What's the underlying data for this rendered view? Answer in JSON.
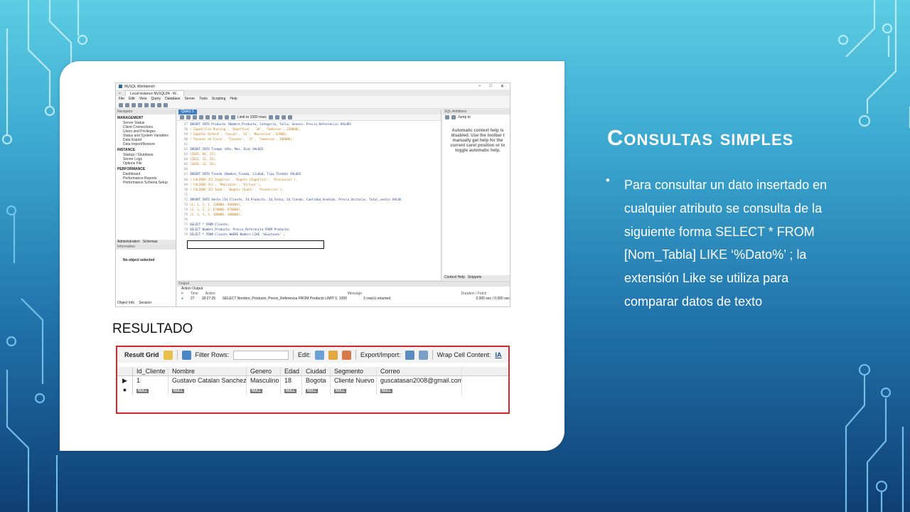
{
  "slide": {
    "title": "Consultas simples",
    "bullet": "Para consultar un dato insertado en cualquier atributo se consulta de la siguiente forma SELECT * FROM  [Nom_Tabla] LIKE ‘%Dato%’ ; la extensión Like se utiliza para comparar datos de texto",
    "resultado_label": "RESULTADO"
  },
  "workbench": {
    "title": "MySQL Workbench",
    "tab": "Local instance MySQL84 - W...",
    "menu": [
      "File",
      "Edit",
      "View",
      "Query",
      "Database",
      "Server",
      "Tools",
      "Scripting",
      "Help"
    ],
    "navigator": {
      "header": "Navigator",
      "management_label": "MANAGEMENT",
      "management_items": [
        "Server Status",
        "Client Connections",
        "Users and Privileges",
        "Status and System Variables",
        "Data Export",
        "Data Import/Restore"
      ],
      "instance_label": "INSTANCE",
      "instance_items": [
        "Startup / Shutdown",
        "Server Logs",
        "Options File"
      ],
      "performance_label": "PERFORMANCE",
      "performance_items": [
        "Dashboard",
        "Performance Reports",
        "Performance Schema Setup"
      ],
      "tabs": [
        "Administration",
        "Schemas"
      ],
      "info_header": "Information",
      "info_text": "No object selected",
      "footer_tabs": [
        "Object Info",
        "Session"
      ]
    },
    "query_tab": "Query 1",
    "limit_label": "Limit to 1000 rows",
    "code_lines": [
      {
        "n": "57",
        "t": "INSERT INTO Producto (Nombre_Producto, Categoria, Talla, Genero, Precio_Referencia) VALUES",
        "s": false
      },
      {
        "n": "58",
        "t": "('Zapatillas Running', 'Deportivo', '38', 'Femenino', 230000),",
        "s": true
      },
      {
        "n": "59",
        "t": "('Zapatos Oxford', 'Casual', '42', 'Masculino', 67000),",
        "s": true
      },
      {
        "n": "60",
        "t": "('Tacones de Cuero', 'Tacones', '37', 'Femenino', 100000);",
        "s": true
      },
      {
        "n": "61",
        "t": "",
        "s": false
      },
      {
        "n": "62",
        "t": "INSERT INTO Tiempo (Año, Mes, Dia) VALUES",
        "s": false
      },
      {
        "n": "63",
        "t": "(2024, 09, 23),",
        "s": true
      },
      {
        "n": "64",
        "t": "(2022, 12, 24),",
        "s": true
      },
      {
        "n": "65",
        "t": "(2024, 12, 24);",
        "s": true
      },
      {
        "n": "66",
        "t": "",
        "s": false
      },
      {
        "n": "67",
        "t": "INSERT INTO Tienda (Nombre_Tienda, Ciudad, Tipo_Tienda) VALUES",
        "s": false
      },
      {
        "n": "68",
        "t": "('CALZADO JC2 Zagatiza', 'Bogota (Zagatiza)', 'Presencial'),",
        "s": true
      },
      {
        "n": "69",
        "t": "('CALZADO JL1', 'Manizales', 'Virtual'),",
        "s": true
      },
      {
        "n": "70",
        "t": "('CALZADO JC2 Suba', 'Bogota (Suba)', 'Presencial');",
        "s": true
      },
      {
        "n": "71",
        "t": "",
        "s": false
      },
      {
        "n": "72",
        "t": "INSERT INTO Venta (Id_Cliente, Id_Producto, Id_Fecha, Id_Tienda, Cantidad_Vendida, Precio_Unitario, Total_venta) VALUE",
        "s": false
      },
      {
        "n": "73",
        "t": "(1, 1, 1, 1, 230000, 460000),",
        "s": true
      },
      {
        "n": "74",
        "t": "(2, 2, 2, 2, 670000, 670000),",
        "s": true
      },
      {
        "n": "75",
        "t": "(3, 3, 3, 3, 100000, 300000);",
        "s": true
      },
      {
        "n": "76",
        "t": "",
        "s": false
      },
      {
        "n": "77",
        "t": "SELECT * FROM Cliente;",
        "s": false
      },
      {
        "n": "78",
        "t": "SELECT Nombre_Producto, Precio_Referencia FROM Producto;",
        "s": false
      },
      {
        "n": "79",
        "t": "SELECT * FROM Cliente WHERE Nombre LIKE '%Gustavo%' ;",
        "s": false
      }
    ],
    "sql_additions": {
      "header": "SQL Additions",
      "jump_to": "Jump to",
      "help": "Automatic context help is disabled. Use the toolbar t manually get help for the current caret position or to toggle automatic help.",
      "tabs": [
        "Context Help",
        "Snippets"
      ]
    },
    "output": {
      "header": "Output",
      "selector": "Action Output",
      "columns": [
        "#",
        "Time",
        "Action",
        "Message",
        "Duration / Fetch"
      ],
      "row": {
        "num": "27",
        "time": "18:27:25",
        "action": "SELECT Nombre_Producto, Precio_Referencia FROM Producto LIMIT 0, 1000",
        "message": "3 row(s) returned",
        "duration": "0.000 sec / 0.000 sec"
      }
    }
  },
  "result_grid": {
    "toolbar": {
      "result_grid": "Result Grid",
      "filter_rows": "Filter Rows:",
      "edit": "Edit:",
      "export_import": "Export/Import:",
      "wrap": "Wrap Cell Content:"
    },
    "columns": [
      "Id_Cliente",
      "Nombre",
      "Genero",
      "Edad",
      "Ciudad",
      "Segmento",
      "Correo"
    ],
    "rows": [
      [
        "1",
        "Gustavo Catalan Sanchez",
        "Masculino",
        "18",
        "Bogota",
        "Cliente Nuevo",
        "guscatasan2008@gmail.com"
      ]
    ],
    "null_label": "NULL"
  },
  "colors": {
    "accent_red": "#d9262c",
    "query_tab_blue": "#3d7fc6"
  }
}
